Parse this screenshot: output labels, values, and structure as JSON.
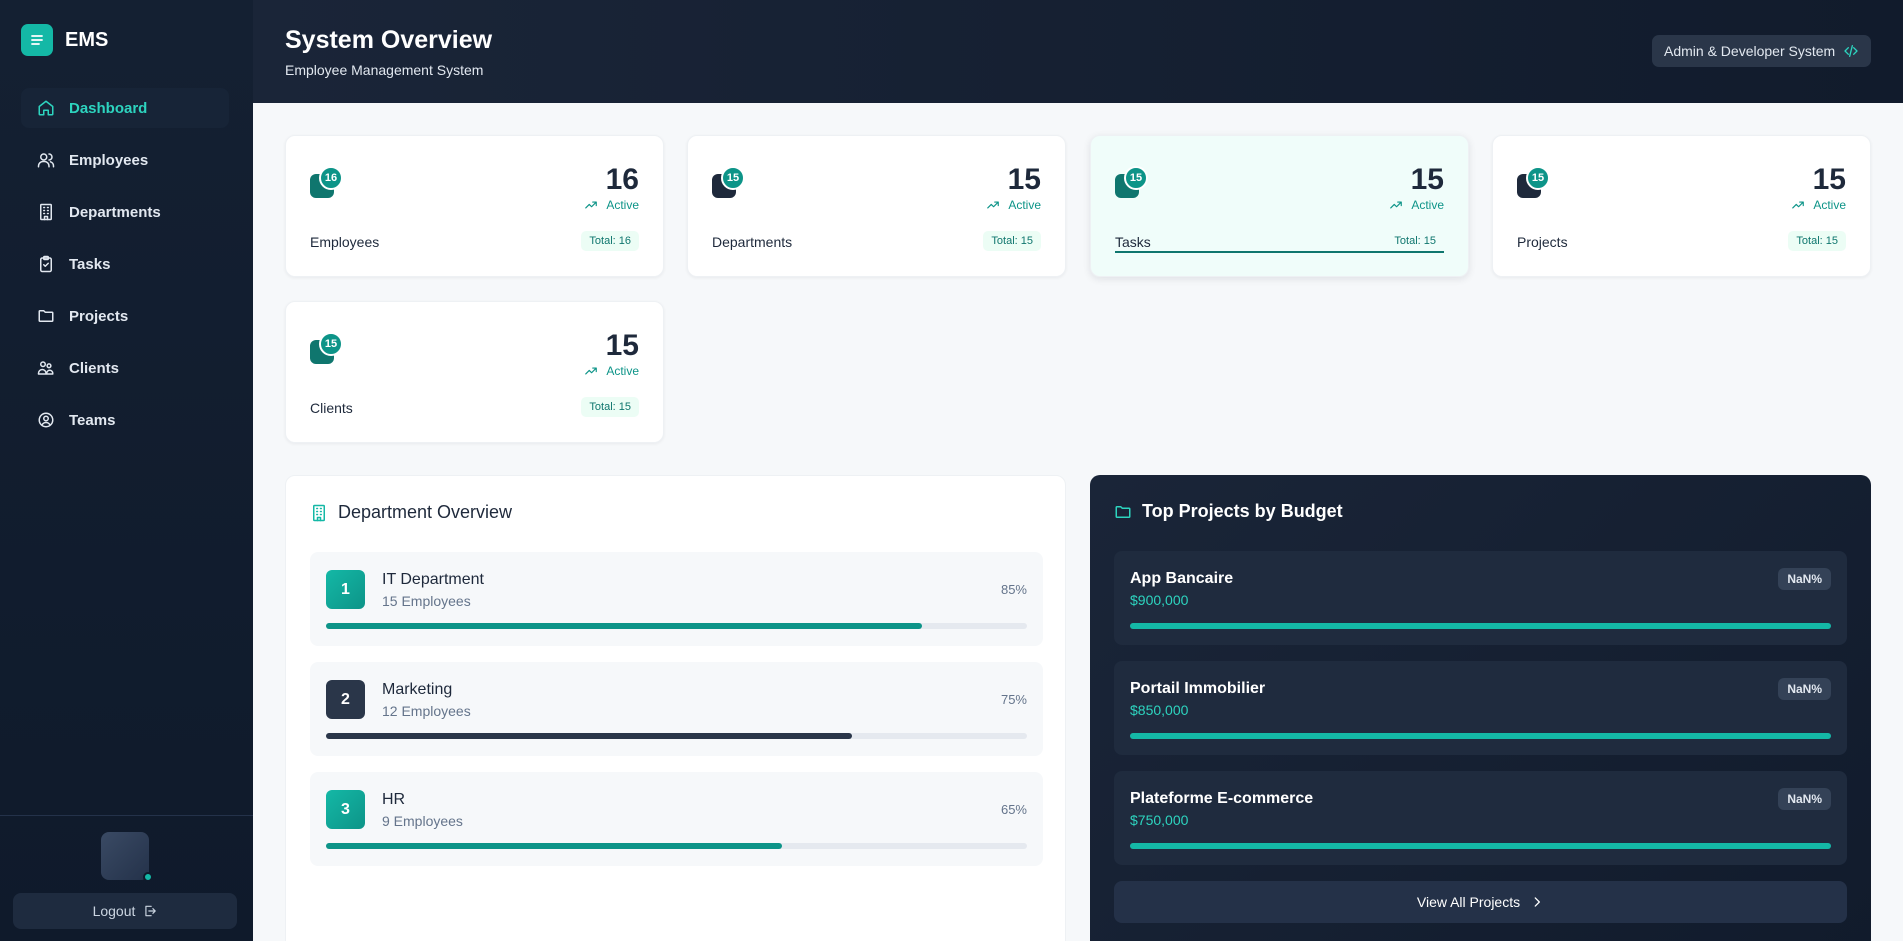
{
  "sidebar": {
    "brand": "EMS",
    "items": [
      {
        "label": "Dashboard",
        "icon": "home-icon",
        "active": true
      },
      {
        "label": "Employees",
        "icon": "users-icon"
      },
      {
        "label": "Departments",
        "icon": "building-icon"
      },
      {
        "label": "Tasks",
        "icon": "clipboard-icon"
      },
      {
        "label": "Projects",
        "icon": "folder-icon"
      },
      {
        "label": "Clients",
        "icon": "clients-icon"
      },
      {
        "label": "Teams",
        "icon": "team-icon"
      }
    ],
    "logout_label": "Logout"
  },
  "header": {
    "title": "System Overview",
    "subtitle": "Employee Management System",
    "badge": "Admin & Developer System"
  },
  "stats": [
    {
      "label": "Employees",
      "value": "16",
      "badge": "16",
      "status": "Active",
      "total": "Total: 16"
    },
    {
      "label": "Departments",
      "value": "15",
      "badge": "15",
      "status": "Active",
      "total": "Total: 15"
    },
    {
      "label": "Tasks",
      "value": "15",
      "badge": "15",
      "status": "Active",
      "total": "Total: 15"
    },
    {
      "label": "Projects",
      "value": "15",
      "badge": "15",
      "status": "Active",
      "total": "Total: 15"
    },
    {
      "label": "Clients",
      "value": "15",
      "badge": "15",
      "status": "Active",
      "total": "Total: 15"
    }
  ],
  "departments": {
    "title": "Department Overview",
    "items": [
      {
        "rank": "1",
        "name": "IT Department",
        "employees": "15 Employees",
        "percent_label": "85%",
        "progress": 0.85
      },
      {
        "rank": "2",
        "name": "Marketing",
        "employees": "12 Employees",
        "percent_label": "75%",
        "progress": 0.75
      },
      {
        "rank": "3",
        "name": "HR",
        "employees": "9 Employees",
        "percent_label": "65%",
        "progress": 0.65
      }
    ]
  },
  "projects": {
    "title": "Top Projects by Budget",
    "items": [
      {
        "name": "App Bancaire",
        "budget": "$900,000",
        "percent_label": "NaN%",
        "progress": 1.0
      },
      {
        "name": "Portail Immobilier",
        "budget": "$850,000",
        "percent_label": "NaN%",
        "progress": 1.0
      },
      {
        "name": "Plateforme E-commerce",
        "budget": "$750,000",
        "percent_label": "NaN%",
        "progress": 1.0
      }
    ],
    "view_all_label": "View All Projects"
  },
  "colors": {
    "accent": "#14b8a6",
    "accent_dark": "#0d9488",
    "navy": "#111b2c"
  }
}
